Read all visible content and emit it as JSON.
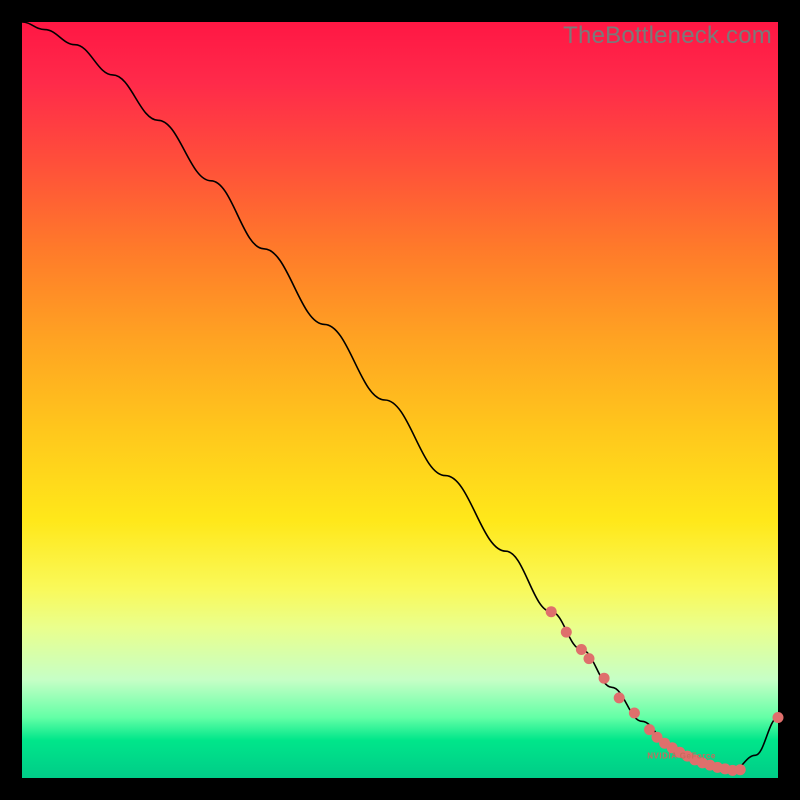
{
  "watermark": "TheBottleneck.com",
  "chart_data": {
    "type": "line",
    "title": "",
    "xlabel": "",
    "ylabel": "",
    "xlim": [
      0,
      100
    ],
    "ylim": [
      0,
      100
    ],
    "grid": false,
    "legend": false,
    "background_gradient": {
      "stops": [
        {
          "pos": 0.0,
          "color": "#ff1744"
        },
        {
          "pos": 0.5,
          "color": "#ffd61a"
        },
        {
          "pos": 0.95,
          "color": "#00e68a"
        },
        {
          "pos": 1.0,
          "color": "#00cc88"
        }
      ]
    },
    "series": [
      {
        "name": "curve",
        "x": [
          0,
          3,
          7,
          12,
          18,
          25,
          32,
          40,
          48,
          56,
          64,
          70,
          74,
          78,
          82,
          86,
          90,
          94,
          97,
          100
        ],
        "y": [
          100,
          99,
          97,
          93,
          87,
          79,
          70,
          60,
          50,
          40,
          30,
          22,
          17,
          12,
          7.5,
          4,
          2,
          1,
          3,
          8
        ]
      }
    ],
    "highlighted_points": {
      "name": "markers",
      "x": [
        70,
        72,
        74,
        75,
        77,
        79,
        81,
        83,
        84,
        85,
        86,
        87,
        88,
        89,
        90,
        91,
        92,
        93,
        94,
        95,
        100
      ],
      "y": [
        22.0,
        19.3,
        17.0,
        15.8,
        13.2,
        10.6,
        8.6,
        6.4,
        5.4,
        4.6,
        4.0,
        3.4,
        2.9,
        2.4,
        2.0,
        1.7,
        1.4,
        1.2,
        1.0,
        1.1,
        8.0
      ]
    },
    "annotation": {
      "text": "NVIDIA GeForce",
      "x": 88,
      "y": 3
    }
  },
  "colors": {
    "curve": "#000000",
    "marker": "#df6f6c",
    "watermark": "#7a7a7a"
  }
}
